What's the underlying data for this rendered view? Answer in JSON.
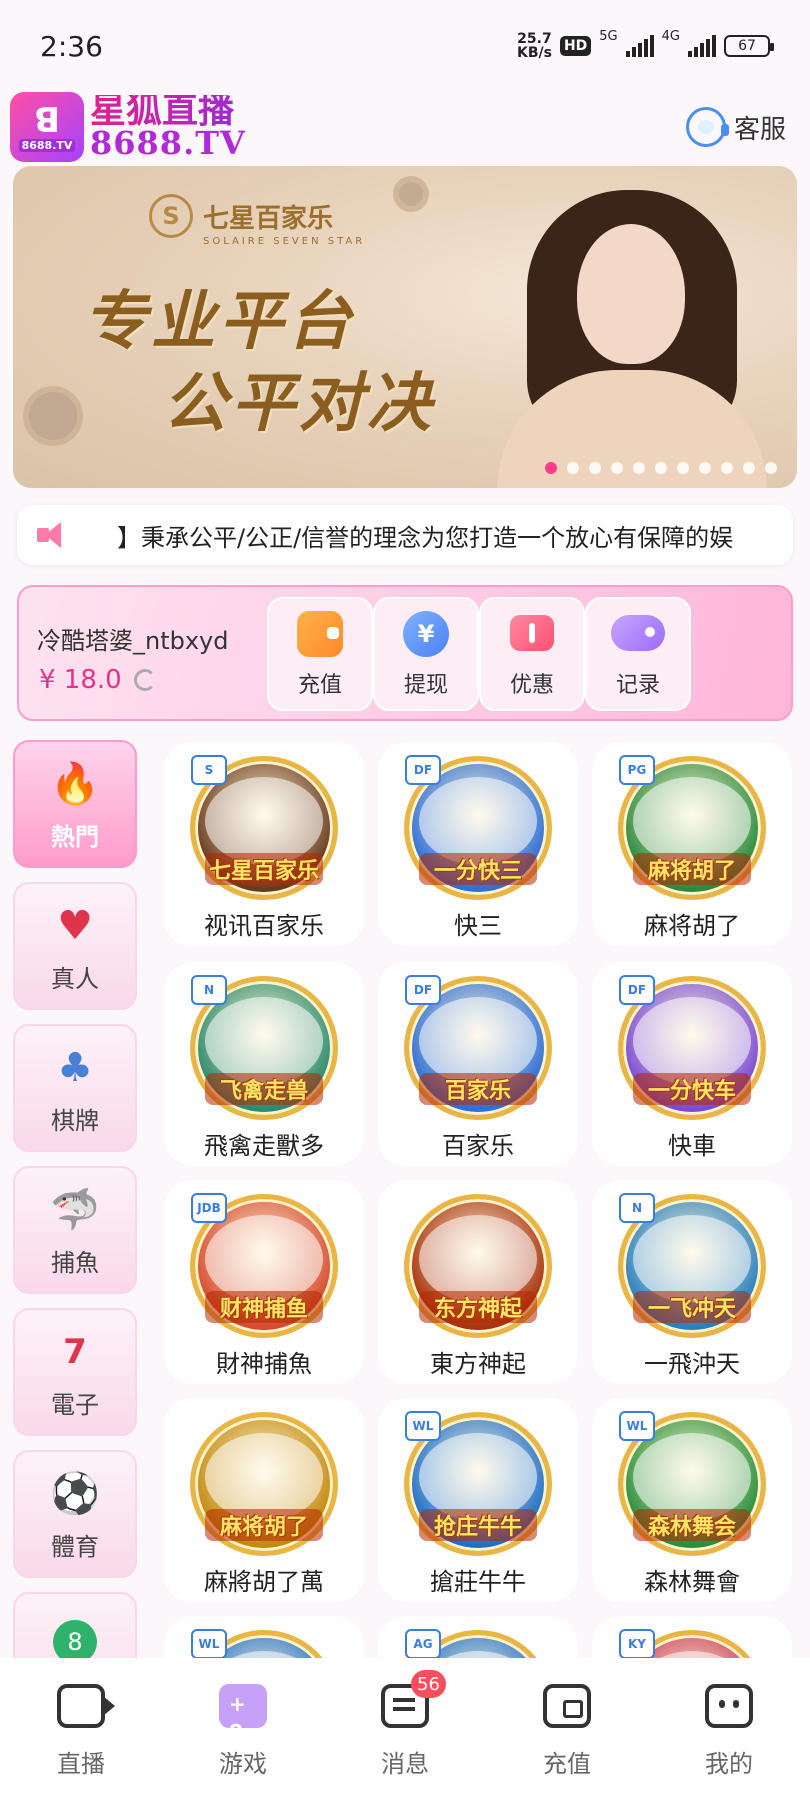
{
  "status_bar": {
    "time": "2:36",
    "speed_value": "25.7",
    "speed_unit": "KB/s",
    "hd": "HD",
    "net1": "5G",
    "net2": "4G",
    "battery": "67"
  },
  "header": {
    "logo_small": "8688.TV",
    "brand_cn": "星狐直播",
    "brand_en": "8688.TV",
    "service_label": "客服"
  },
  "banner": {
    "brand_name": "七星百家乐",
    "brand_sub": "SOLAIRE SEVEN STAR",
    "slogan_line1": "专业平台",
    "slogan_line2": "公平对决",
    "slide_count": 11,
    "active_slide": 1
  },
  "notice": {
    "text": "】秉承公平/公正/信誉的理念为您打造一个放心有保障的娱"
  },
  "account": {
    "username": "冷酷塔婆_ntbxyd",
    "balance": "¥ 18.0",
    "actions": [
      {
        "label": "充值",
        "icon": "recharge-icon"
      },
      {
        "label": "提现",
        "icon": "withdraw-icon"
      },
      {
        "label": "优惠",
        "icon": "offer-icon"
      },
      {
        "label": "记录",
        "icon": "record-icon"
      }
    ]
  },
  "categories": [
    {
      "label": "熱門",
      "icon": "🔥",
      "active": true
    },
    {
      "label": "真人",
      "icon": "♥"
    },
    {
      "label": "棋牌",
      "icon": "♣"
    },
    {
      "label": "捕魚",
      "icon": "🦈"
    },
    {
      "label": "電子",
      "icon": "7"
    },
    {
      "label": "體育",
      "icon": "⚽"
    },
    {
      "label": "",
      "icon": "8"
    }
  ],
  "games": [
    {
      "name": "视讯百家乐",
      "tag": "七星百家乐",
      "badge": "S",
      "color": "#6b3a1f"
    },
    {
      "name": "快三",
      "tag": "一分快三",
      "badge": "DF",
      "color": "#2f6fd6"
    },
    {
      "name": "麻将胡了",
      "tag": "麻将胡了",
      "badge": "PG",
      "color": "#2d8a3e"
    },
    {
      "name": "飛禽走獸多",
      "tag": "飞禽走兽",
      "badge": "N",
      "color": "#2d8a6e"
    },
    {
      "name": "百家乐",
      "tag": "百家乐",
      "badge": "DF",
      "color": "#2f6fd6"
    },
    {
      "name": "快車",
      "tag": "一分快车",
      "badge": "DF",
      "color": "#7b4bd6"
    },
    {
      "name": "財神捕魚",
      "tag": "财神捕鱼",
      "badge": "JDB",
      "color": "#d64b2f"
    },
    {
      "name": "東方神起",
      "tag": "东方神起",
      "badge": "",
      "color": "#a8330f"
    },
    {
      "name": "一飛沖天",
      "tag": "一飞冲天",
      "badge": "N",
      "color": "#2a7fbf"
    },
    {
      "name": "麻將胡了萬",
      "tag": "麻将胡了",
      "badge": "",
      "color": "#c48a10"
    },
    {
      "name": "搶莊牛牛",
      "tag": "抢庄牛牛",
      "badge": "WL",
      "color": "#1f6fc9"
    },
    {
      "name": "森林舞會",
      "tag": "森林舞会",
      "badge": "WL",
      "color": "#2a8f3a"
    },
    {
      "name": "",
      "tag": "",
      "badge": "WL",
      "color": "#1f6fc9"
    },
    {
      "name": "",
      "tag": "",
      "badge": "AG",
      "color": "#1f6fc9"
    },
    {
      "name": "",
      "tag": "",
      "badge": "KY",
      "color": "#c93a5a"
    }
  ],
  "tabbar": [
    {
      "label": "直播",
      "icon": "live-camera-icon"
    },
    {
      "label": "游戏",
      "icon": "gamepad-icon",
      "active": true
    },
    {
      "label": "消息",
      "icon": "message-icon",
      "badge": "56"
    },
    {
      "label": "充值",
      "icon": "wallet-icon"
    },
    {
      "label": "我的",
      "icon": "profile-icon"
    }
  ]
}
